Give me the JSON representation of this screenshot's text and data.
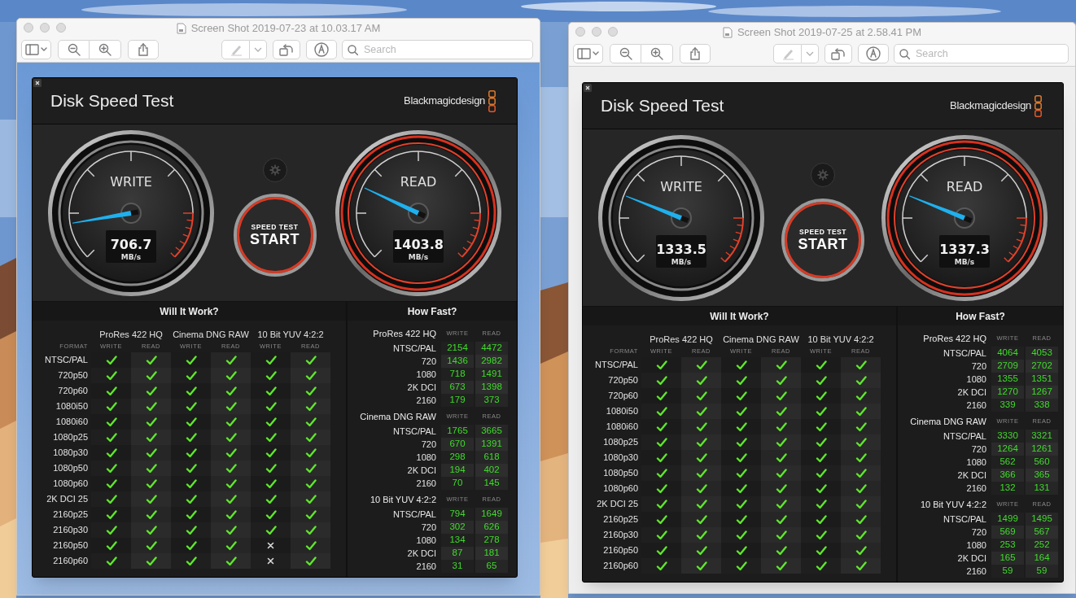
{
  "windows": [
    {
      "title": "Screen Shot 2019-07-23 at 10.03.17 AM",
      "search": {
        "placeholder": "Search"
      },
      "app": {
        "title": "Disk Speed Test",
        "brand": "Blackmagicdesign",
        "gauges": [
          {
            "kind": "write",
            "label": "WRITE",
            "reading": "706.7",
            "unit": "MB/s"
          },
          {
            "kind": "read",
            "label": "READ",
            "reading": "1403.8",
            "unit": "MB/s"
          }
        ],
        "start_button": {
          "caption": "SPEED TEST",
          "label": "START"
        },
        "will_it_work": {
          "title": "Will It Work?",
          "format_label": "FORMAT",
          "groups": [
            {
              "name": "ProRes 422 HQ",
              "columns": [
                "WRITE",
                "READ"
              ]
            },
            {
              "name": "Cinema DNG RAW",
              "columns": [
                "WRITE",
                "READ"
              ]
            },
            {
              "name": "10 Bit YUV 4:2:2",
              "columns": [
                "WRITE",
                "READ"
              ]
            }
          ],
          "rows": [
            {
              "format": "NTSC/PAL",
              "works": [
                true,
                true,
                true,
                true,
                true,
                true
              ]
            },
            {
              "format": "720p50",
              "works": [
                true,
                true,
                true,
                true,
                true,
                true
              ]
            },
            {
              "format": "720p60",
              "works": [
                true,
                true,
                true,
                true,
                true,
                true
              ]
            },
            {
              "format": "1080i50",
              "works": [
                true,
                true,
                true,
                true,
                true,
                true
              ]
            },
            {
              "format": "1080i60",
              "works": [
                true,
                true,
                true,
                true,
                true,
                true
              ]
            },
            {
              "format": "1080p25",
              "works": [
                true,
                true,
                true,
                true,
                true,
                true
              ]
            },
            {
              "format": "1080p30",
              "works": [
                true,
                true,
                true,
                true,
                true,
                true
              ]
            },
            {
              "format": "1080p50",
              "works": [
                true,
                true,
                true,
                true,
                true,
                true
              ]
            },
            {
              "format": "1080p60",
              "works": [
                true,
                true,
                true,
                true,
                true,
                true
              ]
            },
            {
              "format": "2K DCI 25",
              "works": [
                true,
                true,
                true,
                true,
                true,
                true
              ]
            },
            {
              "format": "2160p25",
              "works": [
                true,
                true,
                true,
                true,
                true,
                true
              ]
            },
            {
              "format": "2160p30",
              "works": [
                true,
                true,
                true,
                true,
                true,
                true
              ]
            },
            {
              "format": "2160p50",
              "works": [
                true,
                true,
                true,
                true,
                false,
                true
              ]
            },
            {
              "format": "2160p60",
              "works": [
                true,
                true,
                true,
                true,
                false,
                true
              ]
            }
          ]
        },
        "how_fast": {
          "title": "How Fast?",
          "sections": [
            {
              "name": "ProRes 422 HQ",
              "columns": [
                "WRITE",
                "READ"
              ],
              "rows": [
                {
                  "label": "NTSC/PAL",
                  "write": "2154",
                  "read": "4472"
                },
                {
                  "label": "720",
                  "write": "1436",
                  "read": "2982"
                },
                {
                  "label": "1080",
                  "write": "718",
                  "read": "1491"
                },
                {
                  "label": "2K DCI",
                  "write": "673",
                  "read": "1398"
                },
                {
                  "label": "2160",
                  "write": "179",
                  "read": "373"
                }
              ]
            },
            {
              "name": "Cinema DNG RAW",
              "columns": [
                "WRITE",
                "READ"
              ],
              "rows": [
                {
                  "label": "NTSC/PAL",
                  "write": "1765",
                  "read": "3665"
                },
                {
                  "label": "720",
                  "write": "670",
                  "read": "1391"
                },
                {
                  "label": "1080",
                  "write": "298",
                  "read": "618"
                },
                {
                  "label": "2K DCI",
                  "write": "194",
                  "read": "402"
                },
                {
                  "label": "2160",
                  "write": "70",
                  "read": "145"
                }
              ]
            },
            {
              "name": "10 Bit YUV 4:2:2",
              "columns": [
                "WRITE",
                "READ"
              ],
              "rows": [
                {
                  "label": "NTSC/PAL",
                  "write": "794",
                  "read": "1649"
                },
                {
                  "label": "720",
                  "write": "302",
                  "read": "626"
                },
                {
                  "label": "1080",
                  "write": "134",
                  "read": "278"
                },
                {
                  "label": "2K DCI",
                  "write": "87",
                  "read": "181"
                },
                {
                  "label": "2160",
                  "write": "31",
                  "read": "65"
                }
              ]
            }
          ]
        }
      }
    },
    {
      "title": "Screen Shot 2019-07-25 at 2.58.41 PM",
      "search": {
        "placeholder": "Search"
      },
      "app": {
        "title": "Disk Speed Test",
        "brand": "Blackmagicdesign",
        "gauges": [
          {
            "kind": "write",
            "label": "WRITE",
            "reading": "1333.5",
            "unit": "MB/s"
          },
          {
            "kind": "read",
            "label": "READ",
            "reading": "1337.3",
            "unit": "MB/s"
          }
        ],
        "start_button": {
          "caption": "SPEED TEST",
          "label": "START"
        },
        "will_it_work": {
          "title": "Will It Work?",
          "format_label": "FORMAT",
          "groups": [
            {
              "name": "ProRes 422 HQ",
              "columns": [
                "WRITE",
                "READ"
              ]
            },
            {
              "name": "Cinema DNG RAW",
              "columns": [
                "WRITE",
                "READ"
              ]
            },
            {
              "name": "10 Bit YUV 4:2:2",
              "columns": [
                "WRITE",
                "READ"
              ]
            }
          ],
          "rows": [
            {
              "format": "NTSC/PAL",
              "works": [
                true,
                true,
                true,
                true,
                true,
                true
              ]
            },
            {
              "format": "720p50",
              "works": [
                true,
                true,
                true,
                true,
                true,
                true
              ]
            },
            {
              "format": "720p60",
              "works": [
                true,
                true,
                true,
                true,
                true,
                true
              ]
            },
            {
              "format": "1080i50",
              "works": [
                true,
                true,
                true,
                true,
                true,
                true
              ]
            },
            {
              "format": "1080i60",
              "works": [
                true,
                true,
                true,
                true,
                true,
                true
              ]
            },
            {
              "format": "1080p25",
              "works": [
                true,
                true,
                true,
                true,
                true,
                true
              ]
            },
            {
              "format": "1080p30",
              "works": [
                true,
                true,
                true,
                true,
                true,
                true
              ]
            },
            {
              "format": "1080p50",
              "works": [
                true,
                true,
                true,
                true,
                true,
                true
              ]
            },
            {
              "format": "1080p60",
              "works": [
                true,
                true,
                true,
                true,
                true,
                true
              ]
            },
            {
              "format": "2K DCI 25",
              "works": [
                true,
                true,
                true,
                true,
                true,
                true
              ]
            },
            {
              "format": "2160p25",
              "works": [
                true,
                true,
                true,
                true,
                true,
                true
              ]
            },
            {
              "format": "2160p30",
              "works": [
                true,
                true,
                true,
                true,
                true,
                true
              ]
            },
            {
              "format": "2160p50",
              "works": [
                true,
                true,
                true,
                true,
                true,
                true
              ]
            },
            {
              "format": "2160p60",
              "works": [
                true,
                true,
                true,
                true,
                true,
                true
              ]
            }
          ]
        },
        "how_fast": {
          "title": "How Fast?",
          "sections": [
            {
              "name": "ProRes 422 HQ",
              "columns": [
                "WRITE",
                "READ"
              ],
              "rows": [
                {
                  "label": "NTSC/PAL",
                  "write": "4064",
                  "read": "4053"
                },
                {
                  "label": "720",
                  "write": "2709",
                  "read": "2702"
                },
                {
                  "label": "1080",
                  "write": "1355",
                  "read": "1351"
                },
                {
                  "label": "2K DCI",
                  "write": "1270",
                  "read": "1267"
                },
                {
                  "label": "2160",
                  "write": "339",
                  "read": "338"
                }
              ]
            },
            {
              "name": "Cinema DNG RAW",
              "columns": [
                "WRITE",
                "READ"
              ],
              "rows": [
                {
                  "label": "NTSC/PAL",
                  "write": "3330",
                  "read": "3321"
                },
                {
                  "label": "720",
                  "write": "1264",
                  "read": "1261"
                },
                {
                  "label": "1080",
                  "write": "562",
                  "read": "560"
                },
                {
                  "label": "2K DCI",
                  "write": "366",
                  "read": "365"
                },
                {
                  "label": "2160",
                  "write": "132",
                  "read": "131"
                }
              ]
            },
            {
              "name": "10 Bit YUV 4:2:2",
              "columns": [
                "WRITE",
                "READ"
              ],
              "rows": [
                {
                  "label": "NTSC/PAL",
                  "write": "1499",
                  "read": "1495"
                },
                {
                  "label": "720",
                  "write": "569",
                  "read": "567"
                },
                {
                  "label": "1080",
                  "write": "253",
                  "read": "252"
                },
                {
                  "label": "2K DCI",
                  "write": "165",
                  "read": "164"
                },
                {
                  "label": "2160",
                  "write": "59",
                  "read": "59"
                }
              ]
            }
          ]
        }
      }
    }
  ]
}
